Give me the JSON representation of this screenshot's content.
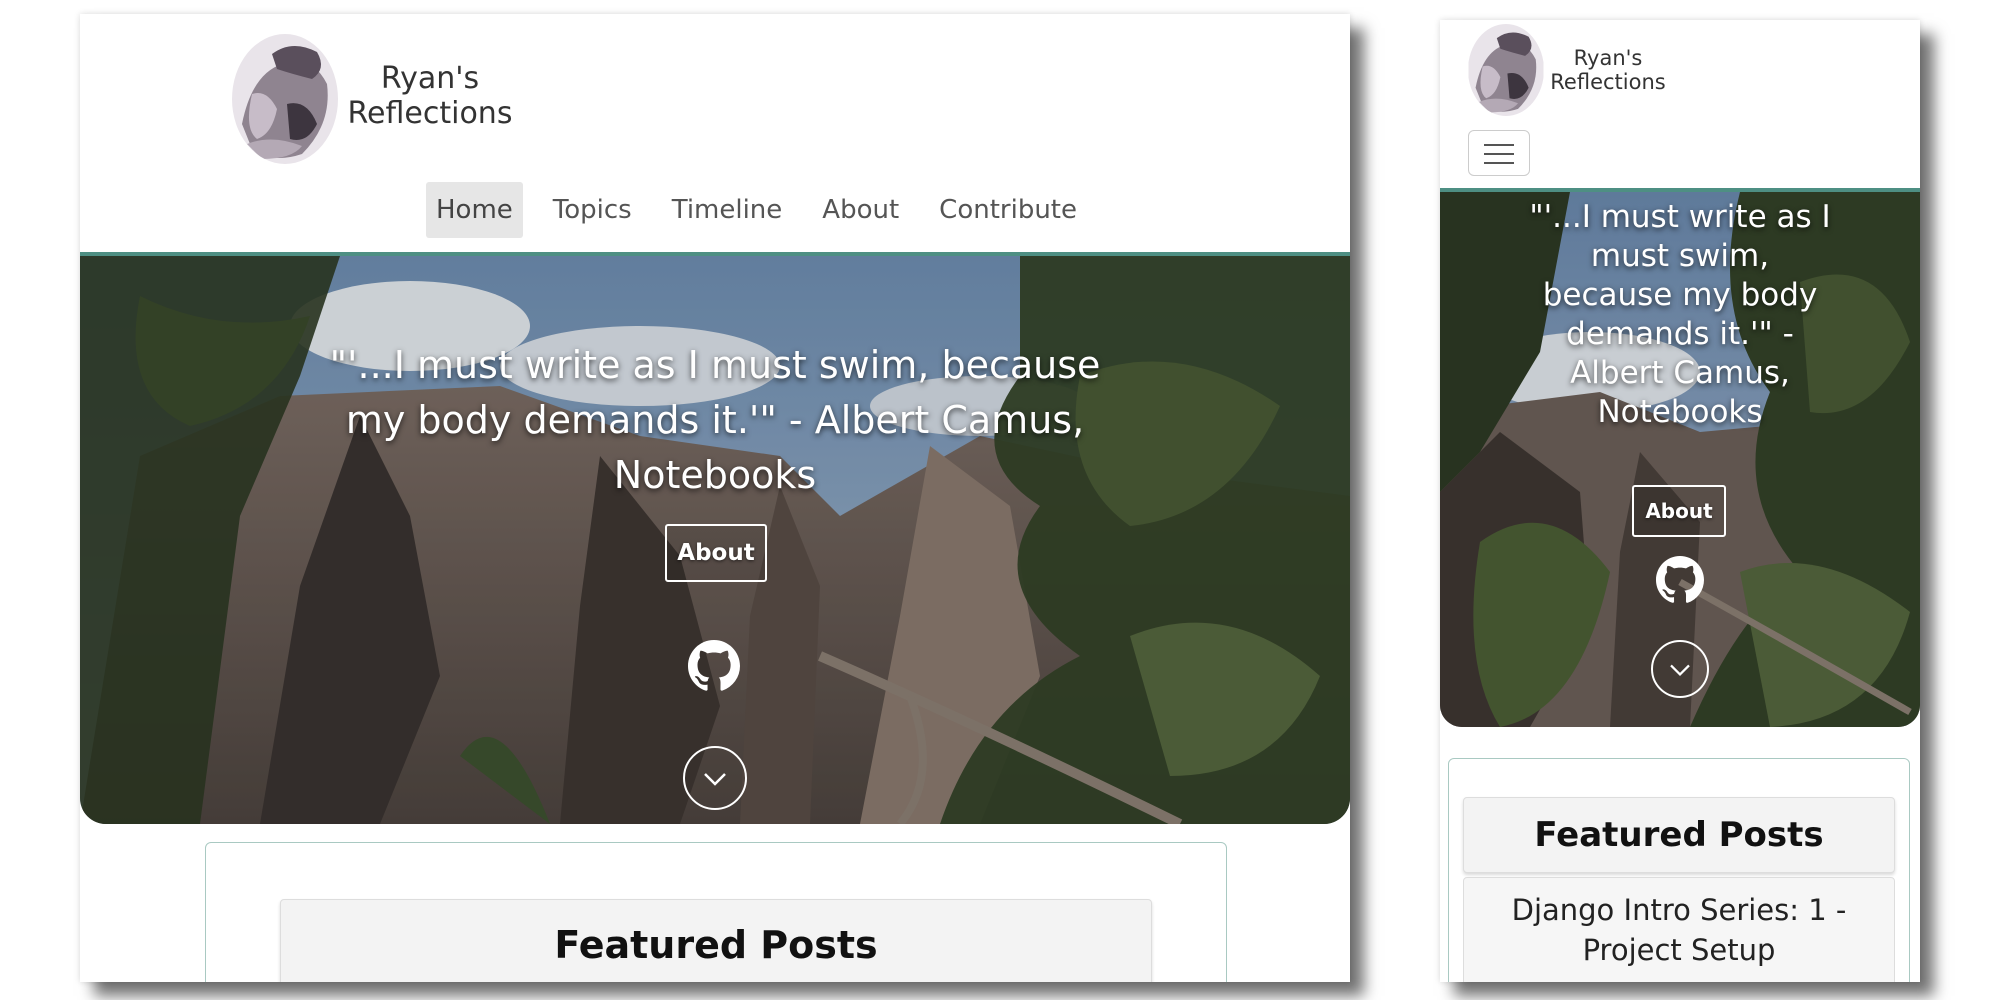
{
  "site": {
    "name_line1": "Ryan's",
    "name_line2": "Reflections"
  },
  "nav": {
    "items": [
      "Home",
      "Topics",
      "Timeline",
      "About",
      "Contribute"
    ],
    "active": "Home"
  },
  "hero": {
    "quote_desktop": [
      "\"'...I must write as I must swim, because",
      "my body demands it.'\" - Albert Camus,",
      "Notebooks"
    ],
    "quote_mobile": [
      "\"'...I must write as I",
      "must swim,",
      "because my body",
      "demands it.'\" -",
      "Albert Camus,",
      "Notebooks"
    ],
    "about_label": "About",
    "github_icon": "github-icon",
    "scroll_icon": "chevron-down-circle-icon"
  },
  "featured": {
    "heading": "Featured Posts",
    "posts": [
      {
        "title_line1": "Django Intro Series: 1 -",
        "title_line2": "Project Setup"
      }
    ]
  },
  "colors": {
    "accent": "#4e8f83",
    "card_border": "#a9c9c2"
  }
}
